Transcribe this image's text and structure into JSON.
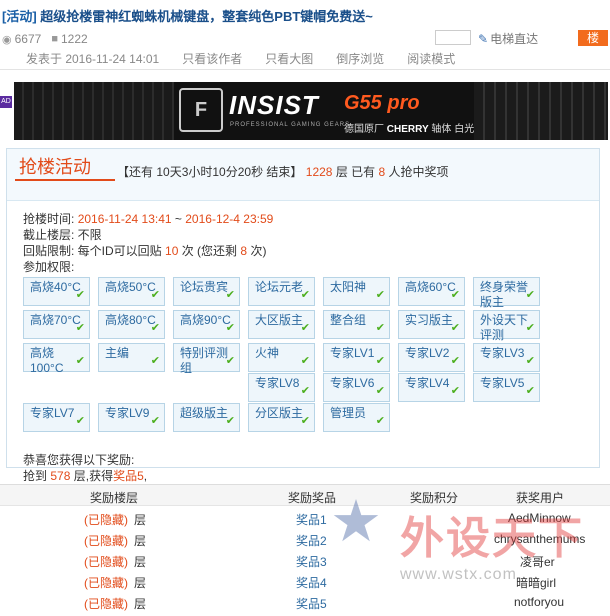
{
  "thread": {
    "tag": "[活动]",
    "title": "超级抢楼雷神红蜘蛛机械键盘，整套纯色PBT键帽免费送~",
    "views": "6677",
    "replies": "1222",
    "jump_label": "电梯直达",
    "floor_badge": "楼"
  },
  "toolbar": {
    "posted": "发表于 2016-11-24 14:01",
    "only_author": "只看该作者",
    "only_big": "只看大图",
    "reverse": "倒序浏览",
    "read_mode": "阅读模式"
  },
  "banner": {
    "brand": "INSIST",
    "brand_sub": "PROFESSIONAL GAMING GEARS",
    "model": "G55 pro",
    "model_sub_pre": "德国原厂",
    "model_sub_brand": "CHERRY",
    "model_sub_post": "轴体 白光跳灯",
    "ad_mark": "广告"
  },
  "lottery": {
    "title": "抢楼活动",
    "info_prefix": "【还有",
    "countdown": "10天3小时10分20秒",
    "info_end": "结束】",
    "floors": "1228",
    "floors_unit": "层 已有",
    "winners": "8",
    "winners_unit": "人抢中奖项",
    "time_label": "抢楼时间:",
    "time_start": "2016-11-24 13:41",
    "time_sep": "~",
    "time_end": "2016-12-4 23:59",
    "cutoff": "截止楼层: 不限",
    "reply_limit_pre": "回贴限制: 每个ID可以回贴",
    "reply_limit_num": "10",
    "reply_limit_mid": "次 (您还剩",
    "reply_limit_left": "8",
    "reply_limit_post": "次)",
    "perm_label": "参加权限:",
    "permissions": [
      "高烧40°C",
      "高烧50°C",
      "论坛贵宾",
      "论坛元老",
      "太阳神",
      "高烧60°C",
      "终身荣誉版主",
      "高烧70°C",
      "高烧80°C",
      "高烧90°C",
      "大区版主",
      "整合组",
      "实习版主",
      "外设天下评测",
      "高烧100°C",
      "主编",
      "特别评测组",
      "火神",
      "专家LV1",
      "专家LV2",
      "专家LV3",
      "专家LV8",
      "专家LV6",
      "专家LV4",
      "专家LV5",
      "专家LV7",
      "专家LV9",
      "超级版主",
      "分区版主",
      "管理员"
    ],
    "congrats": "恭喜您获得以下奖励:",
    "reward_pre": "抢到",
    "reward_floor": "578",
    "reward_mid": "层,获得",
    "reward_prize": "奖品5",
    "reward_post": ","
  },
  "awards": {
    "headers": [
      "奖励楼层",
      "奖励奖品",
      "奖励积分",
      "获奖用户"
    ],
    "rows": [
      {
        "floor": "(已隐藏)",
        "unit": "层",
        "prize": "奖品1",
        "user": "AedMinnow"
      },
      {
        "floor": "(已隐藏)",
        "unit": "层",
        "prize": "奖品2",
        "user": "chrysanthemums"
      },
      {
        "floor": "(已隐藏)",
        "unit": "层",
        "prize": "奖品3",
        "user": "凌哥er"
      },
      {
        "floor": "(已隐藏)",
        "unit": "层",
        "prize": "奖品4",
        "user": "暗暗girl"
      },
      {
        "floor": "(已隐藏)",
        "unit": "层",
        "prize": "奖品5",
        "user": "notforyou"
      }
    ]
  },
  "watermark": {
    "text": "外设天下",
    "url": "www.wstx.com"
  },
  "colors": {
    "accent_red": "#e24b1a",
    "link_blue": "#1a4f8a",
    "perm_bg": "#eef6fb",
    "check_green": "#4caf1e",
    "badge_orange": "#f26b1d"
  }
}
